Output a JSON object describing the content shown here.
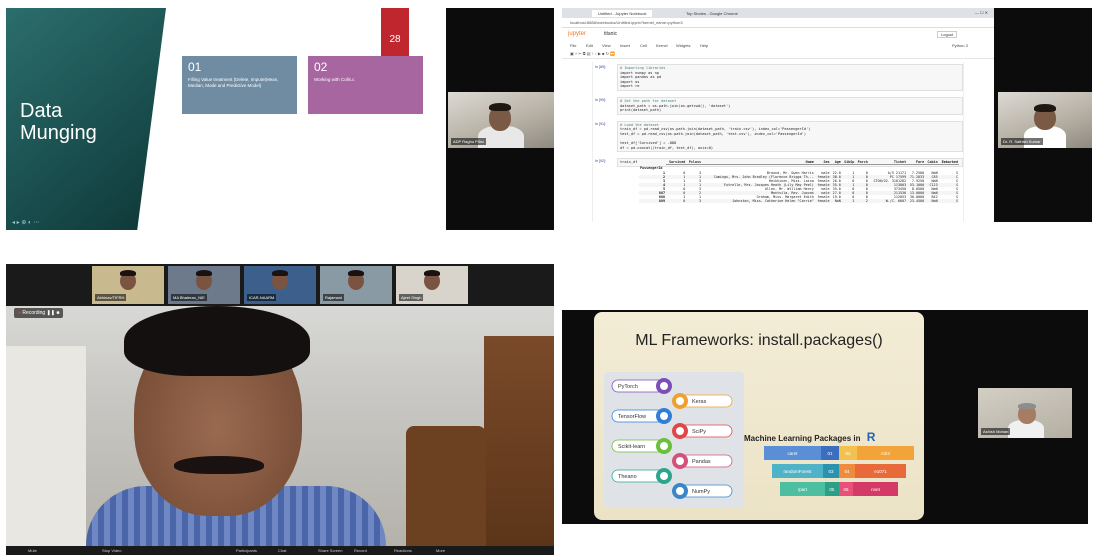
{
  "panel1": {
    "slide_title_line1": "Data",
    "slide_title_line2": "Munging",
    "slide_number": "28",
    "card1_number": "01",
    "card1_text": "Filling Value treatment (Delete, Impute(Mean, Median, Mode and Predictive Model)",
    "card2_number": "02",
    "card2_text": "Working with Colls.c",
    "colors": {
      "teal": "#1d5c5c",
      "card1": "#6e8aa0",
      "card2": "#a766a0",
      "red": "#c0262d"
    }
  },
  "panel2": {
    "browser_tab1": "Untitled - Jupyter Notebook",
    "browser_tab2": "Top Stories - Google Chrome",
    "url": "localhost:8888/notebooks/Untitled.ipynb?kernel_name=python3",
    "notebook_brand": "jupyter",
    "notebook_name": "titanic",
    "logout_label": "Logout",
    "kernel_label": "Python 3",
    "menu_items": [
      "File",
      "Edit",
      "View",
      "Insert",
      "Cell",
      "Kernel",
      "Widgets",
      "Help"
    ],
    "cells": [
      {
        "prompt": "In [89]:",
        "lines": [
          "# Importing libraries",
          "import numpy as np",
          "import pandas as pd",
          "import os",
          "import re"
        ]
      },
      {
        "prompt": "In [90]:",
        "lines": [
          "# Set the path for dataset",
          "dataset_path = os.path.join(os.getcwd(), 'dataset')",
          "print(dataset_path)"
        ]
      },
      {
        "prompt": "In [91]:",
        "lines": [
          "# Load the dataset",
          "train_df = pd.read_csv(os.path.join(dataset_path, 'train.csv'), index_col='PassengerId')",
          "test_df = pd.read_csv(os.path.join(dataset_path, 'test.csv'), index_col='PassengerId')",
          "",
          "test_df['Survived'] = -888",
          "df = pd.concat((train_df, test_df), axis=0)"
        ]
      },
      {
        "prompt": "In [92]:",
        "lines": [
          "train_df"
        ]
      }
    ],
    "table_header": [
      "Survived",
      "Pclass",
      "Name",
      "Sex",
      "Age",
      "SibSp",
      "Parch",
      "Ticket",
      "Fare",
      "Cabin",
      "Embarked"
    ],
    "table_index_header": "PassengerId",
    "rows": [
      [
        "1",
        "0",
        "3",
        "Braund, Mr. Owen Harris",
        "male",
        "22.0",
        "1",
        "0",
        "A/5 21171",
        "7.2500",
        "NaN",
        "S"
      ],
      [
        "2",
        "1",
        "1",
        "Cumings, Mrs. John Bradley (Florence Briggs Th...",
        "female",
        "38.0",
        "1",
        "0",
        "PC 17599",
        "71.2833",
        "C85",
        "C"
      ],
      [
        "3",
        "1",
        "3",
        "Heikkinen, Miss. Laina",
        "female",
        "26.0",
        "0",
        "0",
        "STON/O2. 3101282",
        "7.9250",
        "NaN",
        "S"
      ],
      [
        "4",
        "1",
        "1",
        "Futrelle, Mrs. Jacques Heath (Lily May Peel)",
        "female",
        "35.0",
        "1",
        "0",
        "113803",
        "53.1000",
        "C123",
        "S"
      ],
      [
        "5",
        "0",
        "3",
        "Allen, Mr. William Henry",
        "male",
        "35.0",
        "0",
        "0",
        "373450",
        "8.0500",
        "NaN",
        "S"
      ],
      [
        "887",
        "0",
        "2",
        "Montvila, Rev. Juozas",
        "male",
        "27.0",
        "0",
        "0",
        "211536",
        "13.0000",
        "NaN",
        "S"
      ],
      [
        "888",
        "1",
        "1",
        "Graham, Miss. Margaret Edith",
        "female",
        "19.0",
        "0",
        "0",
        "112053",
        "30.0000",
        "B42",
        "S"
      ],
      [
        "889",
        "0",
        "3",
        "Johnston, Miss. Catherine Helen \"Carrie\"",
        "female",
        "NaN",
        "1",
        "2",
        "W./C. 6607",
        "23.4500",
        "NaN",
        "S"
      ]
    ],
    "side_participant": "Dr. R. Sathish Kumar"
  },
  "panel1_side_participant": "ADP Raghu Pillai",
  "panel3": {
    "recording_label": "Recording",
    "participants": [
      {
        "name": "Abhinav/TIFRH"
      },
      {
        "name": "MA Bhalerao_NIE"
      },
      {
        "name": "ICAR-NAARM"
      },
      {
        "name": "Rajamani"
      },
      {
        "name": "Ajeet Singh"
      }
    ],
    "toolbar": [
      "Mute",
      "Stop Video",
      "Participants",
      "Chat",
      "Share Screen",
      "Record",
      "Reactions",
      "More"
    ]
  },
  "panel4": {
    "slide_title": "ML Frameworks: install.packages()",
    "left_items": [
      "PyTorch",
      "TensorFlow",
      "Scikit-learn",
      "Theano",
      "Keras",
      "SciPy",
      "Pandas",
      "NumPy"
    ],
    "right_title": "Machine Learning Packages in",
    "r_logo": "R",
    "funnel_rows": [
      {
        "left": "caret",
        "n1": "01",
        "n2": "02",
        "right": "mlr3"
      },
      {
        "left": "randomForest",
        "n1": "03",
        "n2": "04",
        "right": "e1071"
      },
      {
        "left": "rpart",
        "n1": "05",
        "n2": "06",
        "right": "nnet"
      }
    ],
    "participant": "Ashish Mohan"
  }
}
